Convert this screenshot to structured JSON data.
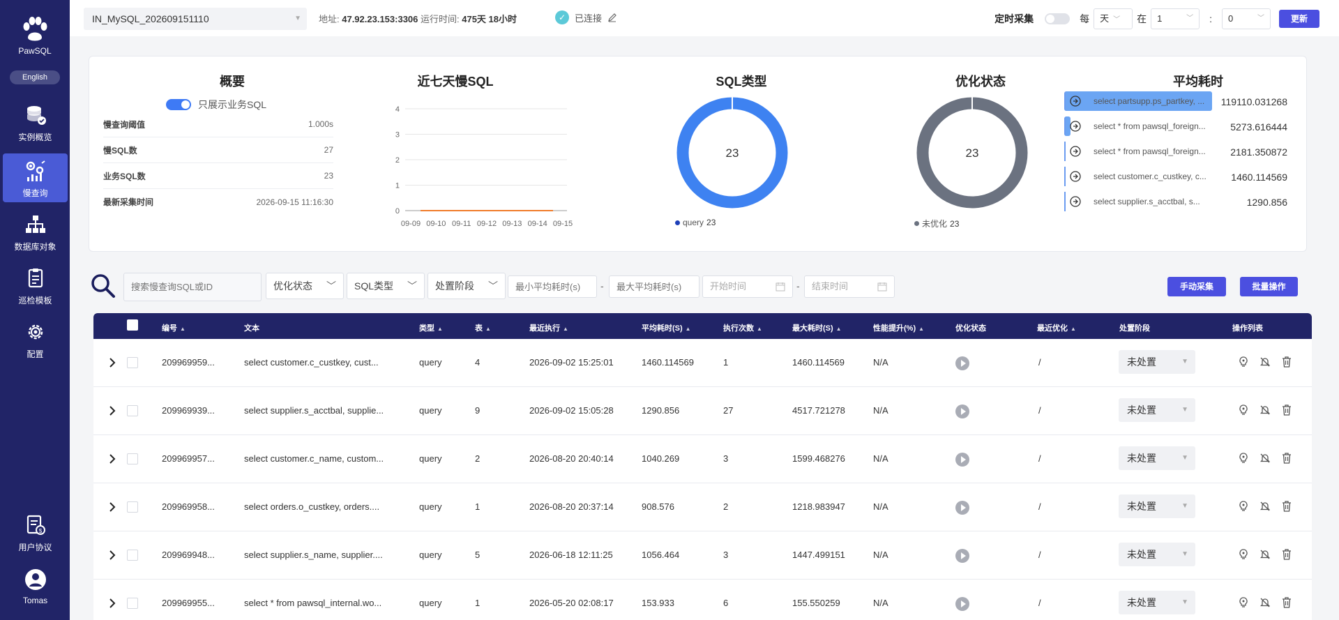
{
  "sidebar": {
    "app_name": "PawSQL",
    "lang_button": "English",
    "items": [
      {
        "label": "实例概览",
        "icon": "database-stack-icon"
      },
      {
        "label": "慢查询",
        "icon": "slow-query-icon"
      },
      {
        "label": "数据库对象",
        "icon": "hierarchy-icon"
      },
      {
        "label": "巡检模板",
        "icon": "clipboard-icon"
      },
      {
        "label": "配置",
        "icon": "gear-icon"
      }
    ],
    "bottom": [
      {
        "label": "用户协议",
        "icon": "agreement-icon"
      },
      {
        "label": "Tomas",
        "icon": "user-avatar-icon"
      }
    ]
  },
  "header": {
    "instance": "IN_MySQL_202609151110",
    "addr_label": "地址: ",
    "addr": "47.92.23.153:3306",
    "runtime_label": " 运行时间: ",
    "runtime": "475天 18小时",
    "status": "已连接",
    "timer_label": "定时采集",
    "every": "每",
    "unit": "天",
    "at": "在",
    "hour": "1",
    "colon": ":",
    "minute": "0",
    "update_button": "更新"
  },
  "overview": {
    "title": "概要",
    "biz_toggle": "只展示业务SQL",
    "rows": [
      {
        "k": "慢查询阈值",
        "v": "1.000s"
      },
      {
        "k": "慢SQL数",
        "v": "27"
      },
      {
        "k": "业务SQL数",
        "v": "23"
      },
      {
        "k": "最新采集时间",
        "v": "2026-09-15 11:16:30"
      }
    ]
  },
  "sql_type": {
    "title": "SQL类型",
    "center": "23",
    "legend_name": "query",
    "legend_value": "23",
    "color": "#3e82f1"
  },
  "opt_status": {
    "title": "优化状态",
    "center": "23",
    "legend_name": "未优化",
    "legend_value": "23",
    "color": "#6b7280"
  },
  "avg_time": {
    "title": "平均耗时",
    "items": [
      {
        "text": "select partsupp.ps_partkey, ...",
        "value": "119110.031268",
        "fraction": 1.0
      },
      {
        "text": "select * from pawsql_foreign...",
        "value": "5273.616444",
        "fraction": 0.044
      },
      {
        "text": "select * from pawsql_foreign...",
        "value": "2181.350872",
        "fraction": 0.018
      },
      {
        "text": "select customer.c_custkey, c...",
        "value": "1460.114569",
        "fraction": 0.012
      },
      {
        "text": "select supplier.s_acctbal, s...",
        "value": "1290.856",
        "fraction": 0.011
      }
    ]
  },
  "chart_data": {
    "type": "line",
    "title": "近七天慢SQL",
    "categories": [
      "09-09",
      "09-10",
      "09-11",
      "09-12",
      "09-13",
      "09-14",
      "09-15"
    ],
    "series": [
      {
        "values": [
          0,
          0,
          0,
          0,
          0,
          0,
          0
        ],
        "color": "#f07c2a"
      }
    ],
    "ylim": [
      0,
      4
    ],
    "yticks": [
      "4",
      "3",
      "2",
      "1",
      "0"
    ],
    "grid": true
  },
  "filters": {
    "search_placeholder": "搜索慢查询SQL或ID",
    "opt_status": "优化状态",
    "sql_type": "SQL类型",
    "stage": "处置阶段",
    "min_avg_placeholder": "最小平均耗时(s)",
    "max_avg_placeholder": "最大平均耗时(s)",
    "start_placeholder": "开始时间",
    "end_placeholder": "结束时间",
    "dash": "-",
    "manual_button": "手动采集",
    "batch_button": "批量操作"
  },
  "table": {
    "headers": {
      "id": "编号",
      "text": "文本",
      "type": "类型",
      "tables": "表",
      "last_exec": "最近执行",
      "avg": "平均耗时(S)",
      "count": "执行次数",
      "max": "最大耗时(S)",
      "perf": "性能提升(%)",
      "opt_status": "优化状态",
      "last_opt": "最近优化",
      "stage": "处置阶段",
      "actions": "操作列表"
    },
    "rows": [
      {
        "id": "209969959...",
        "text": "select customer.c_custkey, cust...",
        "type": "query",
        "tables": "4",
        "last_exec": "2026-09-02 15:25:01",
        "avg": "1460.114569",
        "count": "1",
        "max": "1460.114569",
        "perf": "N/A",
        "last_opt": "/",
        "stage": "未处置"
      },
      {
        "id": "209969939...",
        "text": "select supplier.s_acctbal, supplie...",
        "type": "query",
        "tables": "9",
        "last_exec": "2026-09-02 15:05:28",
        "avg": "1290.856",
        "count": "27",
        "max": "4517.721278",
        "perf": "N/A",
        "last_opt": "/",
        "stage": "未处置"
      },
      {
        "id": "209969957...",
        "text": "select customer.c_name, custom...",
        "type": "query",
        "tables": "2",
        "last_exec": "2026-08-20 20:40:14",
        "avg": "1040.269",
        "count": "3",
        "max": "1599.468276",
        "perf": "N/A",
        "last_opt": "/",
        "stage": "未处置"
      },
      {
        "id": "209969958...",
        "text": "select orders.o_custkey, orders....",
        "type": "query",
        "tables": "1",
        "last_exec": "2026-08-20 20:37:14",
        "avg": "908.576",
        "count": "2",
        "max": "1218.983947",
        "perf": "N/A",
        "last_opt": "/",
        "stage": "未处置"
      },
      {
        "id": "209969948...",
        "text": "select supplier.s_name, supplier....",
        "type": "query",
        "tables": "5",
        "last_exec": "2026-06-18 12:11:25",
        "avg": "1056.464",
        "count": "3",
        "max": "1447.499151",
        "perf": "N/A",
        "last_opt": "/",
        "stage": "未处置"
      },
      {
        "id": "209969955...",
        "text": "select * from pawsql_internal.wo...",
        "type": "query",
        "tables": "1",
        "last_exec": "2026-05-20 02:08:17",
        "avg": "153.933",
        "count": "6",
        "max": "155.550259",
        "perf": "N/A",
        "last_opt": "/",
        "stage": "未处置"
      }
    ]
  }
}
